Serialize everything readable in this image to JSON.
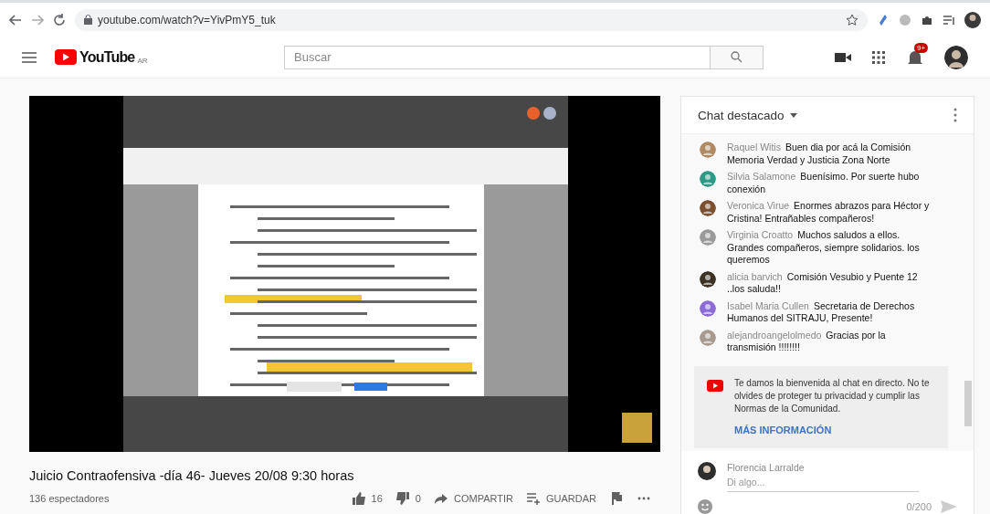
{
  "browser": {
    "url": "youtube.com/watch?v=YivPmY5_tuk"
  },
  "header": {
    "logo": "YouTube",
    "region": "AR",
    "search": {
      "placeholder": "Buscar"
    },
    "notifications": "9+"
  },
  "video": {
    "kind": "picture",
    "title": "Juicio Contraofensiva -día 46- Jueves 20/08 9:30 horas",
    "views": "136 espectadores",
    "likes": "16",
    "dislikes": "0",
    "share": "COMPARTIR",
    "save": "GUARDAR"
  },
  "chat": {
    "title": "Chat destacado",
    "messages": [
      {
        "author": "Raquel Witis",
        "text": "Buen dia por acá la Comisión Memoria Verdad y Justicia Zona Norte",
        "color": "#b08a63"
      },
      {
        "author": "Silvia Salamone",
        "text": "Buenísimo. Por suerte hubo conexión",
        "color": "#2b9a87"
      },
      {
        "author": "Veronica Virue",
        "text": "Enormes abrazos para Héctor y Cristina! Entrañables compañeros!",
        "color": "#7a5030"
      },
      {
        "author": "Virginia Croatto",
        "text": "Muchos saludos a ellos. Grandes compañeros, siempre solidarios. los queremos",
        "color": "#9a9a9a"
      },
      {
        "author": "alicia barvich",
        "text": "Comisión Vesubio y Puente 12 ..los saluda!!",
        "color": "#3b3225"
      },
      {
        "author": "Isabel Maria Cullen",
        "text": "Secretaria de Derechos Humanos del SITRAJU, Presente!",
        "color": "#8d6bd6"
      },
      {
        "author": "alejandroangelolmedo",
        "text": "Gracias por la transmisión !!!!!!!!",
        "color": "#a89a90"
      }
    ],
    "banner": {
      "text": "Te damos la bienvenida al chat en directo. No te olvides de proteger tu privacidad y cumplir las Normas de la Comunidad.",
      "link": "MÁS INFORMACIÓN"
    },
    "input": {
      "author": "Florencia Larralde",
      "placeholder": "Di algo...",
      "counter": "0/200"
    }
  }
}
